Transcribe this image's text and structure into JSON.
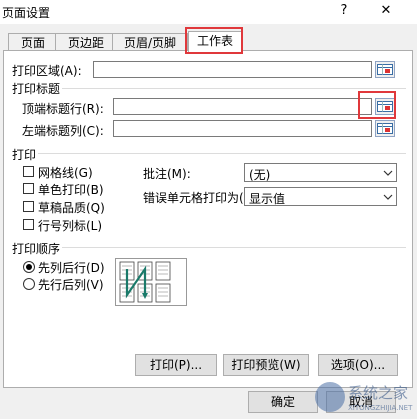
{
  "dialog": {
    "title": "页面设置",
    "help_label": "?",
    "close_label": "✕"
  },
  "tabs": [
    {
      "label": "页面"
    },
    {
      "label": "页边距"
    },
    {
      "label": "页眉/页脚"
    },
    {
      "label": "工作表",
      "active": true
    }
  ],
  "print_area": {
    "label": "打印区域(A):",
    "value": ""
  },
  "print_titles": {
    "heading": "打印标题",
    "rows_label": "顶端标题行(R):",
    "rows_value": "",
    "cols_label": "左端标题列(C):",
    "cols_value": ""
  },
  "print": {
    "heading": "打印",
    "checkboxes": [
      {
        "label": "网格线(G)",
        "checked": false
      },
      {
        "label": "单色打印(B)",
        "checked": false
      },
      {
        "label": "草稿品质(Q)",
        "checked": false
      },
      {
        "label": "行号列标(L)",
        "checked": false
      }
    ],
    "comments_label": "批注(M):",
    "comments_value": "(无)",
    "errors_label": "错误单元格打印为(E):",
    "errors_value": "显示值"
  },
  "page_order": {
    "heading": "打印顺序",
    "options": [
      {
        "label": "先列后行(D)",
        "checked": true
      },
      {
        "label": "先行后列(V)",
        "checked": false
      }
    ]
  },
  "buttons": {
    "print": "打印(P)...",
    "preview": "打印预览(W)",
    "options": "选项(O)...",
    "ok": "确定",
    "cancel": "取消"
  },
  "watermark": {
    "text": "系统之家",
    "url": "XITONGZHIJIA.NET"
  },
  "colors": {
    "highlight": "#e0383b",
    "accent": "#1f5fa8"
  }
}
